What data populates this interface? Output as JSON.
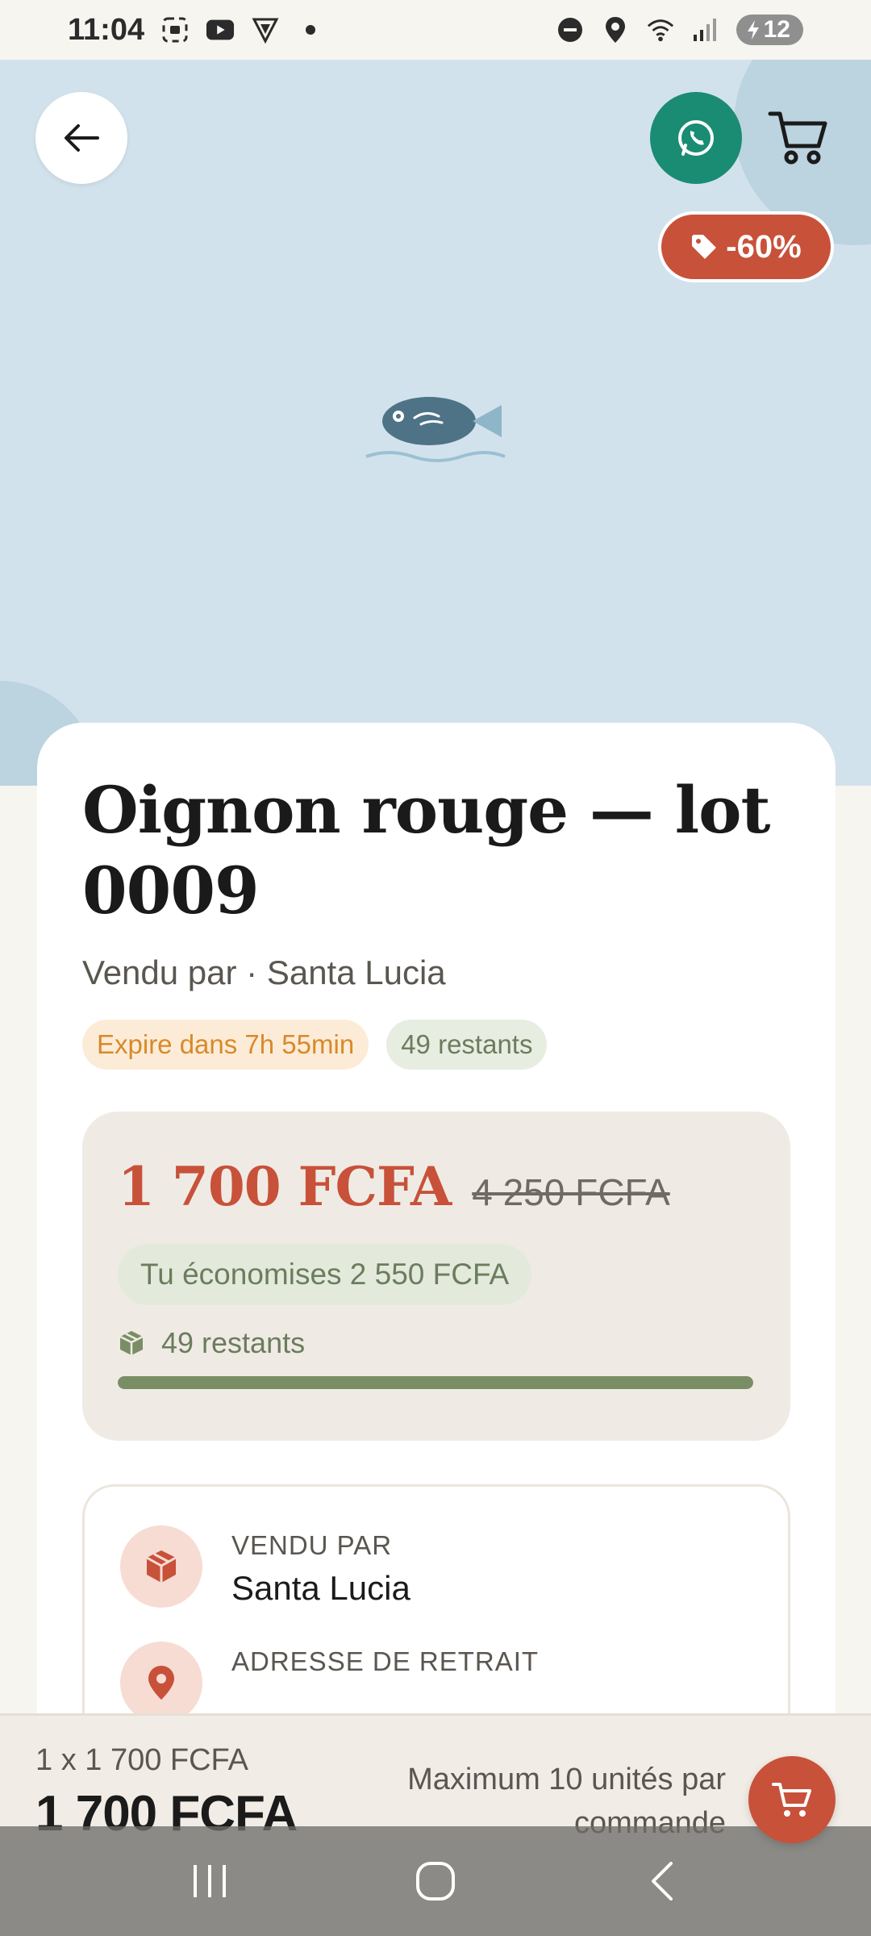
{
  "status_bar": {
    "time": "11:04",
    "battery_level": "12",
    "icons": [
      "screenshot-icon",
      "youtube-icon",
      "vpn-icon",
      "dot-icon",
      "dnd-icon",
      "location-icon",
      "wifi-icon",
      "signal-icon",
      "battery-icon"
    ]
  },
  "hero": {
    "back_icon": "arrow-left-icon",
    "whatsapp_icon": "whatsapp-icon",
    "cart_icon": "cart-icon",
    "discount_label": "-60%",
    "illustration": "fish-icon",
    "colors": {
      "background": "#d2e2ec",
      "accent": "#c8513a",
      "whatsapp": "#1a8c74"
    }
  },
  "product": {
    "title": "Oignon rouge — lot 0009",
    "seller_line": "Vendu par · Santa Lucia",
    "expire_chip": "Expire dans 7h 55min",
    "stock_chip": "49 restants"
  },
  "pricing": {
    "price_now": "1 700 FCFA",
    "price_old": "4 250 FCFA",
    "savings": "Tu économises 2 550 FCFA",
    "stock_label": "49 restants",
    "stock_fraction": 1.0
  },
  "info": {
    "seller_label": "VENDU PAR",
    "seller_value": "Santa Lucia",
    "address_label": "ADRESSE DE RETRAIT"
  },
  "bottom_bar": {
    "qty_line": "1 x 1 700 FCFA",
    "total": "1 700 FCFA",
    "max_note": "Maximum 10 unités par commande"
  }
}
